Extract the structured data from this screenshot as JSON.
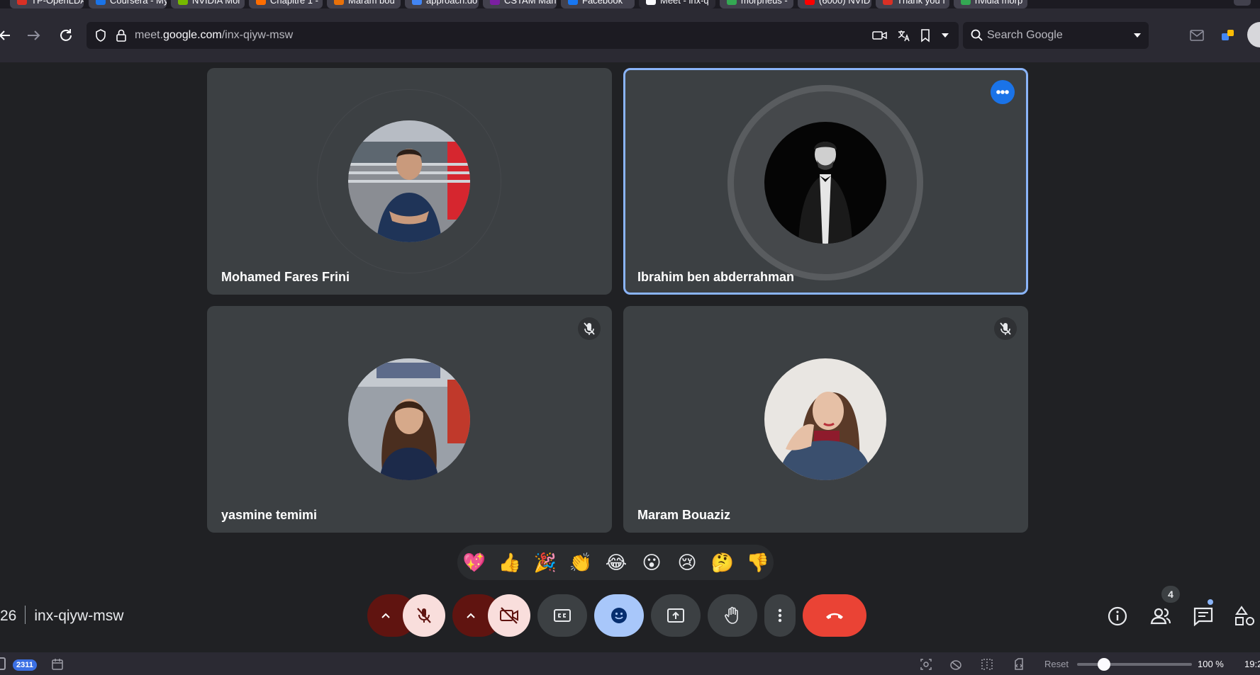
{
  "browser": {
    "tabs": [
      {
        "label": "TP-OpenLDA",
        "color": "#d93025"
      },
      {
        "label": "Coursera - My",
        "color": "#1a73e8"
      },
      {
        "label": "NVIDIA Mor",
        "color": "#76b900"
      },
      {
        "label": "Chapitre 1 -",
        "color": "#ff6d00"
      },
      {
        "label": "Maram bou",
        "color": "#e8710a"
      },
      {
        "label": "approach.do",
        "color": "#4285f4"
      },
      {
        "label": "CSTAM Man",
        "color": "#7b1fa2"
      },
      {
        "label": "Facebook",
        "color": "#1877f2"
      },
      {
        "label": "Meet - inx-q",
        "color": "#fbfbfe"
      },
      {
        "label": "morpheus -",
        "color": "#34a853"
      },
      {
        "label": "(6000) NVID",
        "color": "#ff0000"
      },
      {
        "label": "Thank you f",
        "color": "#d93025"
      },
      {
        "label": "nvidia morp",
        "color": "#34a853"
      }
    ],
    "url_host": "meet.google.com",
    "url_prefix": "meet.",
    "url_domain": "google.com",
    "url_path": "/inx-qiyw-msw",
    "search_placeholder": "Search Google"
  },
  "participants": [
    {
      "name": "Mohamed Fares Frini",
      "muted": false,
      "speaking": false
    },
    {
      "name": "Ibrahim ben abderrahman",
      "muted": false,
      "speaking": true
    },
    {
      "name": "yasmine temimi",
      "muted": true,
      "speaking": false
    },
    {
      "name": "Maram Bouaziz",
      "muted": true,
      "speaking": false
    }
  ],
  "reactions": [
    "💖",
    "👍",
    "🎉",
    "👏",
    "😂",
    "😮",
    "😢",
    "🤔",
    "👎"
  ],
  "meeting": {
    "time_fragment": "26",
    "code": "inx-qiyw-msw",
    "people_count": "4"
  },
  "controls": {
    "mic_state": "off",
    "camera_state": "off",
    "leave_color": "#ea4335",
    "reaction_active_color": "#a8c7fa",
    "mic_off_bg": "#f9dedc",
    "mic_menu_bg": "#601410"
  },
  "statusbar": {
    "count": "2311",
    "reset_label": "Reset",
    "zoom": "100 %",
    "zoom_level_fraction": 0.2,
    "time": "19:2"
  }
}
